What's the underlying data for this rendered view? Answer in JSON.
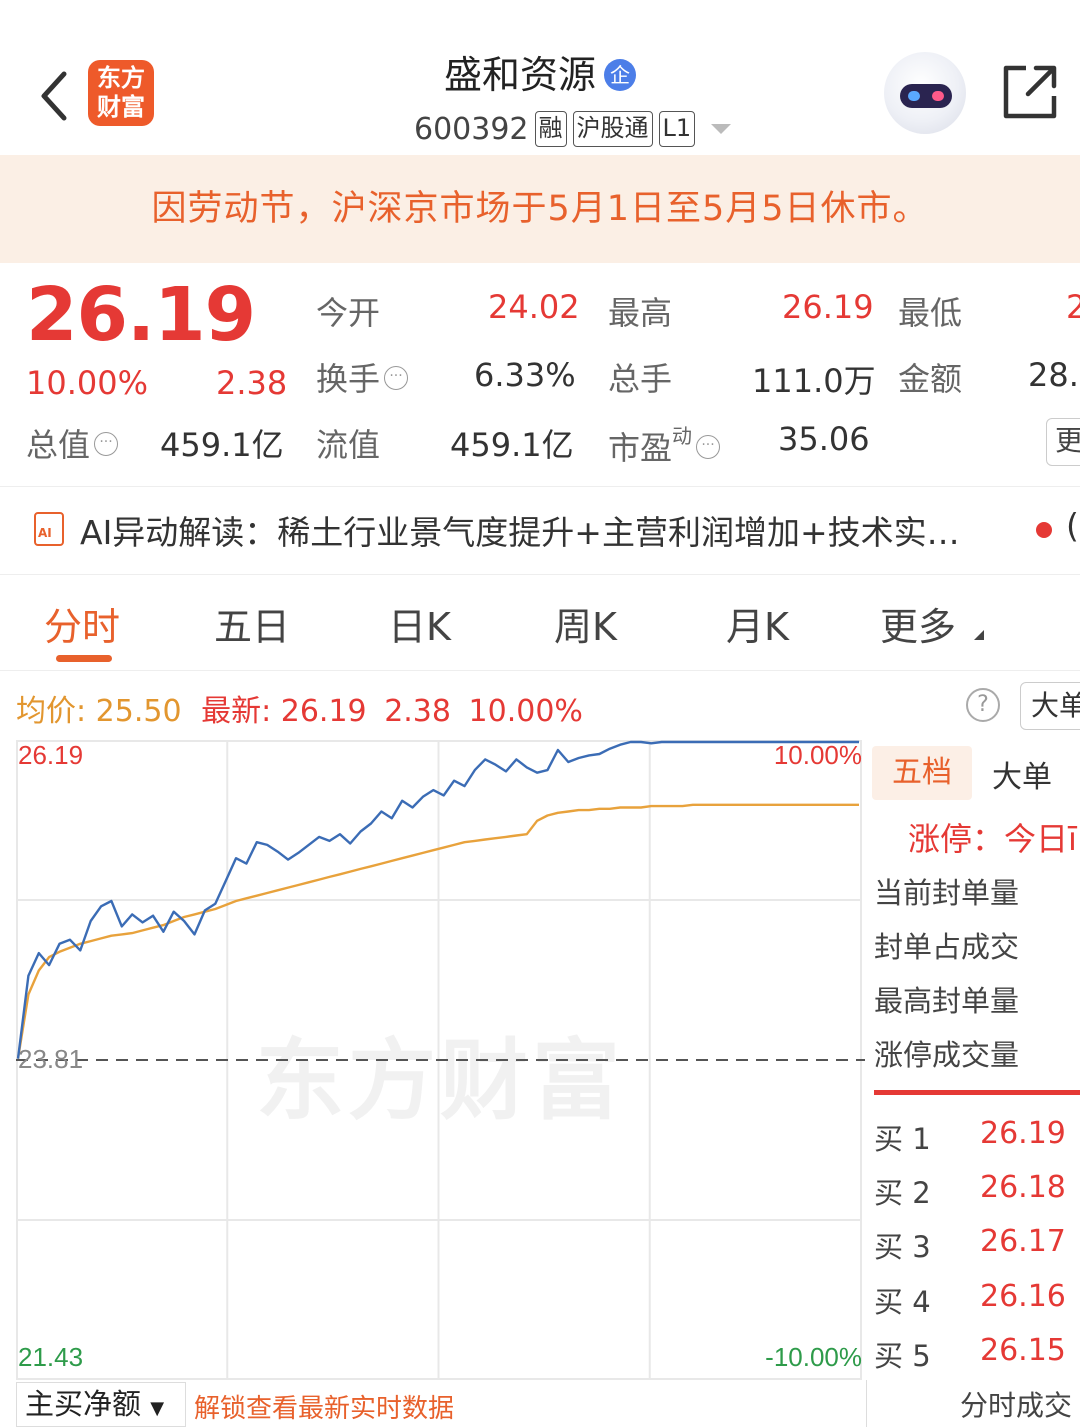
{
  "header": {
    "logo_text": "东方财富",
    "stock_name": "盛和资源",
    "badge": "企",
    "stock_code": "600392",
    "tags": [
      "融",
      "沪股通",
      "L1"
    ]
  },
  "notice": "因劳动节，沪深京市场于5月1日至5月5日休市。",
  "quote": {
    "price": "26.19",
    "change_pct": "10.00%",
    "change": "2.38",
    "rows": [
      {
        "l1": "今开",
        "v1": "24.02",
        "l2": "最高",
        "v2": "26.19",
        "l3": "最低",
        "v3": "2"
      },
      {
        "l1": "换手",
        "v1": "6.33%",
        "l2": "总手",
        "v2": "111.0万",
        "l3": "金额",
        "v3": "28."
      },
      {
        "l1": "流值",
        "v1": "459.1亿",
        "l2": "市盈",
        "v2": "35.06"
      }
    ],
    "total_value_label": "总值",
    "total_value": "459.1亿",
    "pe_sup": "动",
    "right_edge": "更"
  },
  "ai": {
    "icon_text": "AI",
    "text": "AI异动解读：稀土行业景气度提升+主营利润增加+技术实…",
    "trail": "("
  },
  "tabs": [
    "分时",
    "五日",
    "日K",
    "周K",
    "月K",
    "更多"
  ],
  "stats": {
    "avg_label": "均价:",
    "avg_value": "25.50",
    "latest_label": "最新:",
    "latest_value": "26.19",
    "latest_change": "2.38",
    "latest_pct": "10.00%",
    "help": "?",
    "big_button": "大单"
  },
  "chart_data": {
    "type": "line",
    "y_labels_left": [
      "26.19",
      "23.81",
      "21.43"
    ],
    "y_labels_right": [
      "10.00%",
      "-10.00%"
    ],
    "ylim": [
      21.43,
      26.19
    ],
    "prev_close": 23.81,
    "watermark": "东方财富",
    "series": [
      {
        "color": "#3b6cb5",
        "values": [
          23.82,
          24.44,
          24.61,
          24.52,
          24.68,
          24.71,
          24.63,
          24.85,
          24.96,
          25.0,
          24.81,
          24.9,
          24.84,
          24.89,
          24.77,
          24.92,
          24.85,
          24.75,
          24.93,
          24.98,
          25.15,
          25.32,
          25.28,
          25.44,
          25.42,
          25.37,
          25.31,
          25.36,
          25.42,
          25.48,
          25.45,
          25.5,
          25.43,
          25.52,
          25.58,
          25.67,
          25.62,
          25.75,
          25.7,
          25.78,
          25.83,
          25.79,
          25.9,
          25.86,
          25.98,
          26.06,
          26.02,
          25.97,
          26.06,
          26.0,
          25.96,
          25.98,
          26.13,
          26.04,
          26.07,
          26.09,
          26.1,
          26.14,
          26.17,
          26.19,
          26.19,
          26.18,
          26.19,
          26.19,
          26.19,
          26.19,
          26.19,
          26.19,
          26.19,
          26.19,
          26.19,
          26.19,
          26.19,
          26.19,
          26.19,
          26.19,
          26.19,
          26.19,
          26.19,
          26.19,
          26.19,
          26.19
        ]
      },
      {
        "color": "#e8a23c",
        "values": [
          23.82,
          24.3,
          24.48,
          24.58,
          24.62,
          24.65,
          24.68,
          24.7,
          24.72,
          24.74,
          24.75,
          24.76,
          24.78,
          24.8,
          24.82,
          24.85,
          24.88,
          24.9,
          24.92,
          24.94,
          24.97,
          25.0,
          25.02,
          25.04,
          25.06,
          25.08,
          25.1,
          25.12,
          25.14,
          25.16,
          25.18,
          25.2,
          25.22,
          25.24,
          25.26,
          25.28,
          25.3,
          25.32,
          25.34,
          25.36,
          25.38,
          25.4,
          25.42,
          25.44,
          25.45,
          25.46,
          25.47,
          25.48,
          25.49,
          25.5,
          25.6,
          25.64,
          25.66,
          25.67,
          25.68,
          25.68,
          25.69,
          25.69,
          25.7,
          25.7,
          25.7,
          25.71,
          25.71,
          25.71,
          25.71,
          25.72,
          25.72,
          25.72,
          25.72,
          25.72,
          25.72,
          25.72,
          25.72,
          25.72,
          25.72,
          25.72,
          25.72,
          25.72,
          25.72,
          25.72,
          25.72,
          25.72
        ]
      }
    ]
  },
  "panel": {
    "tab_active": "五档",
    "tab_other": "大单",
    "limit_up": "涨停：今日ī",
    "items": [
      "当前封单量",
      "封单占成交",
      "最高封单量",
      "涨停成交量"
    ],
    "buys": [
      {
        "label": "买 1",
        "price": "26.19"
      },
      {
        "label": "买 2",
        "price": "26.18"
      },
      {
        "label": "买 3",
        "price": "26.17"
      },
      {
        "label": "买 4",
        "price": "26.16"
      },
      {
        "label": "买 5",
        "price": "26.15"
      }
    ]
  },
  "bottom": {
    "select_label": "主买净额",
    "unlock": "解锁查看最新实时数据",
    "right": "分时成交"
  },
  "colors": {
    "up": "#e53935",
    "accent": "#e8612c",
    "price_line": "#3b6cb5",
    "avg_line": "#e8a23c"
  }
}
